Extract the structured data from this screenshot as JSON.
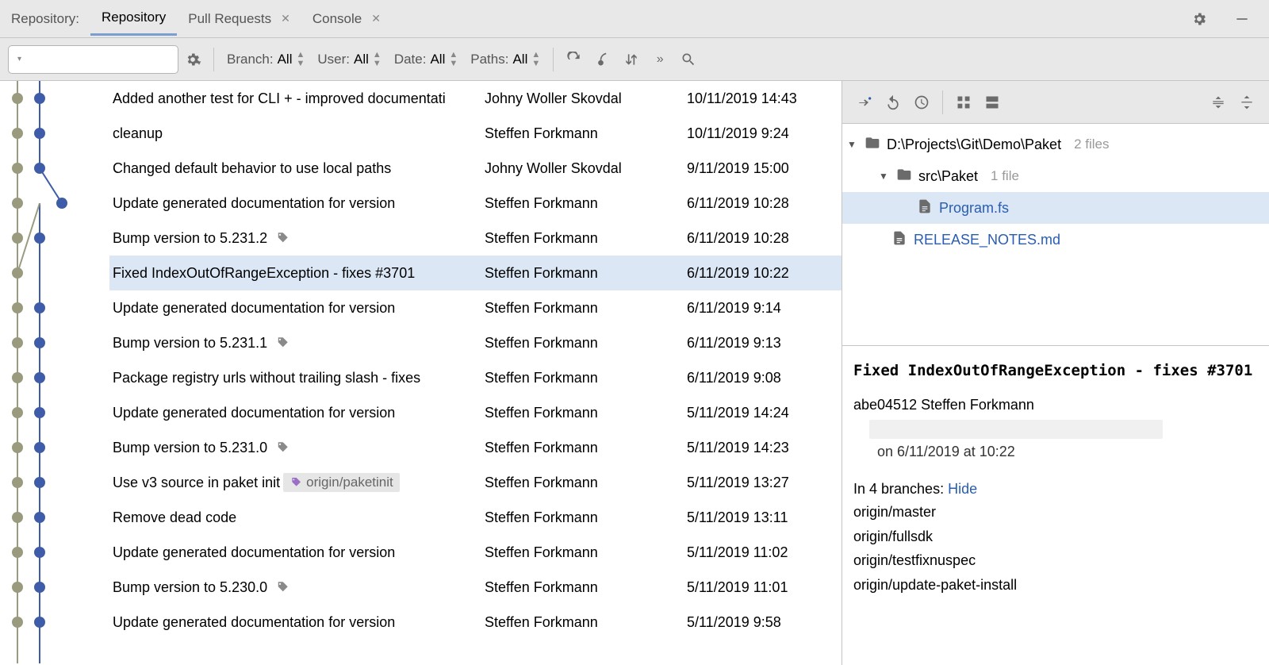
{
  "tabsBar": {
    "label": "Repository:",
    "tabs": [
      {
        "label": "Repository",
        "closable": false,
        "active": true
      },
      {
        "label": "Pull Requests",
        "closable": true,
        "active": false
      },
      {
        "label": "Console",
        "closable": true,
        "active": false
      }
    ]
  },
  "toolbar": {
    "filters": [
      {
        "label": "Branch:",
        "value": "All"
      },
      {
        "label": "User:",
        "value": "All"
      },
      {
        "label": "Date:",
        "value": "All"
      },
      {
        "label": "Paths:",
        "value": "All"
      }
    ],
    "expandLabel": "»"
  },
  "commits": [
    {
      "msg": "Added another test for CLI + - improved documentation",
      "author": "Johny Woller Skovdal",
      "date": "10/11/2019 14:43",
      "tag": false,
      "selected": false
    },
    {
      "msg": "cleanup",
      "author": "Steffen Forkmann",
      "date": "10/11/2019 9:24",
      "tag": false,
      "selected": false
    },
    {
      "msg": "Changed default behavior to use local paths",
      "author": "Johny Woller Skovdal",
      "date": "9/11/2019 15:00",
      "tag": false,
      "selected": false
    },
    {
      "msg": "Update generated documentation for version",
      "author": "Steffen Forkmann",
      "date": "6/11/2019 10:28",
      "tag": false,
      "selected": false
    },
    {
      "msg": "Bump version to 5.231.2",
      "author": "Steffen Forkmann",
      "date": "6/11/2019 10:28",
      "tag": true,
      "selected": false
    },
    {
      "msg": "Fixed IndexOutOfRangeException - fixes #3701",
      "author": "Steffen Forkmann",
      "date": "6/11/2019 10:22",
      "tag": false,
      "selected": true
    },
    {
      "msg": "Update generated documentation for version",
      "author": "Steffen Forkmann",
      "date": "6/11/2019 9:14",
      "tag": false,
      "selected": false
    },
    {
      "msg": "Bump version to 5.231.1",
      "author": "Steffen Forkmann",
      "date": "6/11/2019 9:13",
      "tag": true,
      "selected": false
    },
    {
      "msg": "Package registry urls without trailing slash - fixes",
      "author": "Steffen Forkmann",
      "date": "6/11/2019 9:08",
      "tag": false,
      "selected": false
    },
    {
      "msg": "Update generated documentation for version",
      "author": "Steffen Forkmann",
      "date": "5/11/2019 14:24",
      "tag": false,
      "selected": false
    },
    {
      "msg": "Bump version to 5.231.0",
      "author": "Steffen Forkmann",
      "date": "5/11/2019 14:23",
      "tag": true,
      "selected": false
    },
    {
      "msg": "Use v3 source in paket init",
      "author": "Steffen Forkmann",
      "date": "5/11/2019 13:27",
      "tag": false,
      "branch": "origin/paketinit",
      "selected": false
    },
    {
      "msg": "Remove dead code",
      "author": "Steffen Forkmann",
      "date": "5/11/2019 13:11",
      "tag": false,
      "selected": false
    },
    {
      "msg": "Update generated documentation for version",
      "author": "Steffen Forkmann",
      "date": "5/11/2019 11:02",
      "tag": false,
      "selected": false
    },
    {
      "msg": "Bump version to 5.230.0",
      "author": "Steffen Forkmann",
      "date": "5/11/2019 11:01",
      "tag": true,
      "selected": false
    },
    {
      "msg": "Update generated documentation for version",
      "author": "Steffen Forkmann",
      "date": "5/11/2019 9:58",
      "tag": false,
      "selected": false
    }
  ],
  "fileTree": {
    "root": {
      "name": "D:\\Projects\\Git\\Demo\\Paket",
      "count": "2 files"
    },
    "folder": {
      "name": "src\\Paket",
      "count": "1 file"
    },
    "file1": "Program.fs",
    "file2": "RELEASE_NOTES.md"
  },
  "details": {
    "title": "Fixed IndexOutOfRangeException - fixes #3701",
    "hash": "abe04512",
    "author": "Steffen Forkmann",
    "dateLine": "on 6/11/2019 at 10:22",
    "branchesLabel": "In 4 branches: ",
    "hideLabel": "Hide",
    "branches": [
      "origin/master",
      "origin/fullsdk",
      "origin/testfixnuspec",
      "origin/update-paket-install"
    ]
  }
}
